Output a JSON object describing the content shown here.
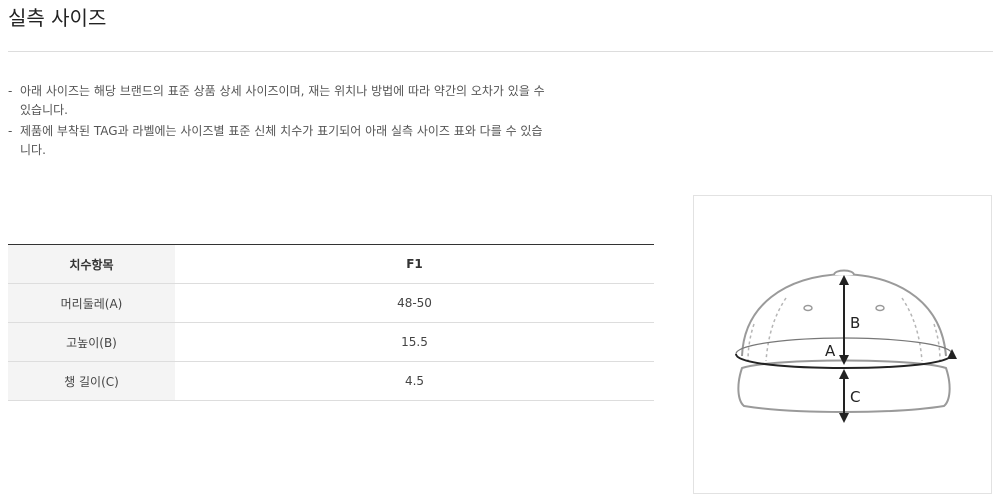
{
  "header": {
    "title": "실측 사이즈"
  },
  "notes": [
    {
      "bullet": "-",
      "text": "아래 사이즈는 해당 브랜드의 표준 상품 상세 사이즈이며, 재는 위치나 방법에 따라 약간의 오차가 있을 수 있습니다."
    },
    {
      "bullet": "-",
      "text": "제품에 부착된 TAG과 라벨에는 사이즈별 표준 신체 치수가 표기되어 아래 실측 사이즈 표와 다를 수 있습니다."
    }
  ],
  "size_table": {
    "header": {
      "label": "치수항목",
      "size": "F1"
    },
    "rows": [
      {
        "label": "머리둘레(A)",
        "value": "48-50"
      },
      {
        "label": "고높이(B)",
        "value": "15.5"
      },
      {
        "label": "챙 길이(C)",
        "value": "4.5"
      }
    ]
  },
  "diagram": {
    "labels": {
      "a": "A",
      "b": "B",
      "c": "C"
    },
    "icon": "cap-measurement-diagram"
  }
}
